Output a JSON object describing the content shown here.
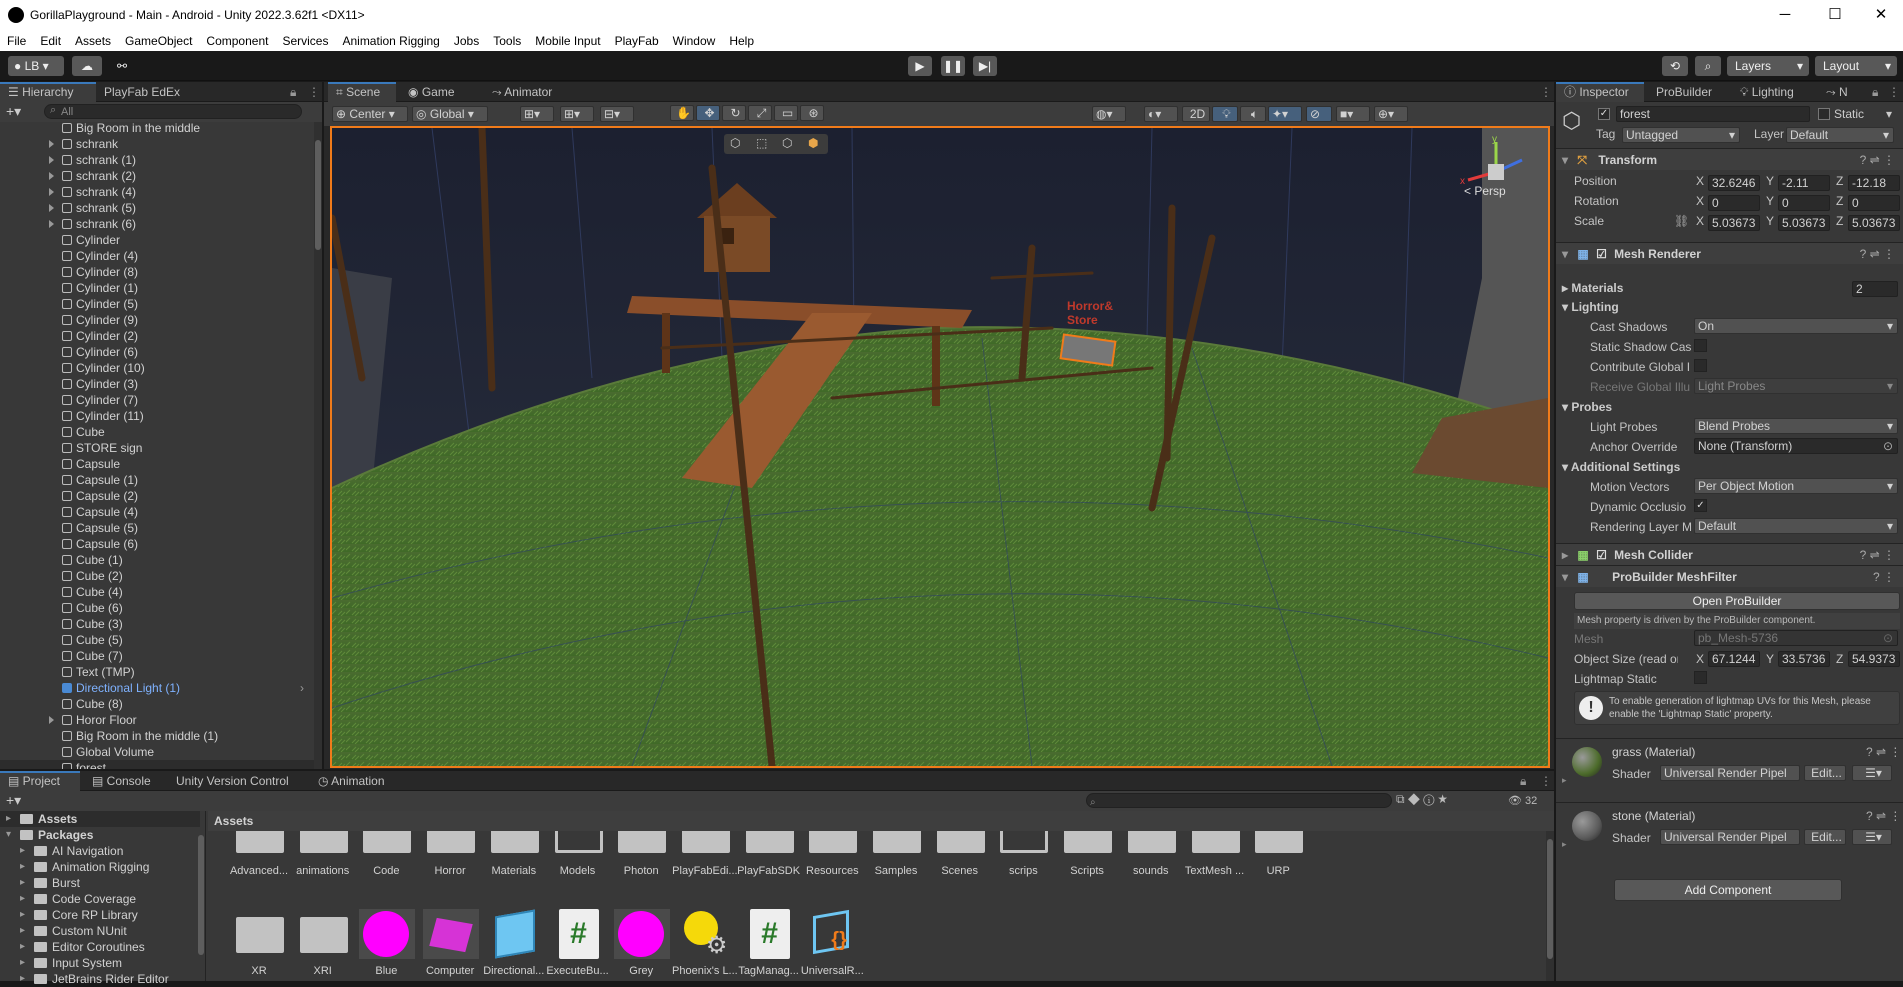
{
  "window": {
    "title": "GorillaPlayground - Main - Android - Unity 2022.3.62f1 <DX11>",
    "minimize": "─",
    "maximize": "☐",
    "close": "✕"
  },
  "menu": [
    "File",
    "Edit",
    "Assets",
    "GameObject",
    "Component",
    "Services",
    "Animation Rigging",
    "Jobs",
    "Tools",
    "Mobile Input",
    "PlayFab",
    "Window",
    "Help"
  ],
  "toolbar": {
    "account": "LB",
    "layers": "Layers",
    "layout": "Layout"
  },
  "hierarchy": {
    "tabs": [
      "Hierarchy",
      "PlayFab EdEx"
    ],
    "search_placeholder": "All",
    "items": [
      {
        "label": "Big Room in the middle",
        "expand": false
      },
      {
        "label": "schrank",
        "expand": true
      },
      {
        "label": "schrank (1)",
        "expand": true
      },
      {
        "label": "schrank (2)",
        "expand": true
      },
      {
        "label": "schrank (4)",
        "expand": true
      },
      {
        "label": "schrank (5)",
        "expand": true
      },
      {
        "label": "schrank (6)",
        "expand": true
      },
      {
        "label": "Cylinder",
        "expand": false
      },
      {
        "label": "Cylinder (4)",
        "expand": false
      },
      {
        "label": "Cylinder (8)",
        "expand": false
      },
      {
        "label": "Cylinder (1)",
        "expand": false
      },
      {
        "label": "Cylinder (5)",
        "expand": false
      },
      {
        "label": "Cylinder (9)",
        "expand": false
      },
      {
        "label": "Cylinder (2)",
        "expand": false
      },
      {
        "label": "Cylinder (6)",
        "expand": false
      },
      {
        "label": "Cylinder (10)",
        "expand": false
      },
      {
        "label": "Cylinder (3)",
        "expand": false
      },
      {
        "label": "Cylinder (7)",
        "expand": false
      },
      {
        "label": "Cylinder (11)",
        "expand": false
      },
      {
        "label": "Cube",
        "expand": false
      },
      {
        "label": "STORE sign",
        "expand": false
      },
      {
        "label": "Capsule",
        "expand": false
      },
      {
        "label": "Capsule (1)",
        "expand": false
      },
      {
        "label": "Capsule (2)",
        "expand": false
      },
      {
        "label": "Capsule (4)",
        "expand": false
      },
      {
        "label": "Capsule (5)",
        "expand": false
      },
      {
        "label": "Capsule (6)",
        "expand": false
      },
      {
        "label": "Cube (1)",
        "expand": false
      },
      {
        "label": "Cube (2)",
        "expand": false
      },
      {
        "label": "Cube (4)",
        "expand": false
      },
      {
        "label": "Cube (6)",
        "expand": false
      },
      {
        "label": "Cube (3)",
        "expand": false
      },
      {
        "label": "Cube (5)",
        "expand": false
      },
      {
        "label": "Cube (7)",
        "expand": false
      },
      {
        "label": "Text (TMP)",
        "expand": false
      },
      {
        "label": "Directional Light (1)",
        "expand": false,
        "highlight": true
      },
      {
        "label": "Cube (8)",
        "expand": false
      },
      {
        "label": "Horor Floor",
        "expand": true
      },
      {
        "label": "Big Room in the middle (1)",
        "expand": false
      },
      {
        "label": "Global Volume",
        "expand": false
      },
      {
        "label": "forest",
        "expand": false
      }
    ]
  },
  "scene": {
    "tabs": [
      "Scene",
      "Game",
      "Animator"
    ],
    "pivot": "Center",
    "space": "Global",
    "mode2d": "2D",
    "persp": "< Persp",
    "sign": "Horror&\nStore"
  },
  "inspector": {
    "tabs": [
      "Inspector",
      "ProBuilder",
      "Lighting",
      "N"
    ],
    "object_name": "forest",
    "static_label": "Static",
    "tag_label": "Tag",
    "tag_value": "Untagged",
    "layer_label": "Layer",
    "layer_value": "Default",
    "transform": {
      "title": "Transform",
      "position_label": "Position",
      "rotation_label": "Rotation",
      "scale_label": "Scale",
      "pos": [
        "32.6246",
        "-2.11",
        "-12.18"
      ],
      "rot": [
        "0",
        "0",
        "0"
      ],
      "scale": [
        "5.03673",
        "5.03673",
        "5.03673"
      ]
    },
    "mesh_renderer": {
      "title": "Mesh Renderer",
      "materials_label": "Materials",
      "materials_count": "2",
      "lighting_label": "Lighting",
      "cast_shadows_label": "Cast Shadows",
      "cast_shadows_value": "On",
      "static_shadow_label": "Static Shadow Cas",
      "contribute_gi_label": "Contribute Global I",
      "receive_gi_label": "Receive Global Illu",
      "receive_gi_value": "Light Probes",
      "probes_label": "Probes",
      "light_probes_label": "Light Probes",
      "light_probes_value": "Blend Probes",
      "anchor_label": "Anchor Override",
      "anchor_value": "None (Transform)",
      "additional_label": "Additional Settings",
      "motion_label": "Motion Vectors",
      "motion_value": "Per Object Motion",
      "dynamic_occ_label": "Dynamic Occlusio",
      "rendering_layer_label": "Rendering Layer M",
      "rendering_layer_value": "Default"
    },
    "mesh_collider": {
      "title": "Mesh Collider"
    },
    "probuilder_meshfilter": {
      "title": "ProBuilder MeshFilter",
      "open_button": "Open ProBuilder",
      "note": "Mesh property is driven by the ProBuilder component.",
      "mesh_label": "Mesh",
      "mesh_value": "pb_Mesh-5736",
      "size_label": "Object Size (read only",
      "size": [
        "67.1244",
        "33.5736",
        "54.9373"
      ],
      "lightmap_label": "Lightmap Static",
      "help": "To enable generation of lightmap UVs for this Mesh, please enable the 'Lightmap Static' property."
    },
    "materials": [
      {
        "name": "grass (Material)",
        "shader_label": "Shader",
        "shader": "Universal Render Pipel",
        "edit": "Edit...",
        "color": "#4c6b2a"
      },
      {
        "name": "stone (Material)",
        "shader_label": "Shader",
        "shader": "Universal Render Pipel",
        "edit": "Edit...",
        "color": "#5b5b5b"
      }
    ],
    "add_component": "Add Component"
  },
  "project": {
    "tabs": [
      "Project",
      "Console",
      "Unity Version Control",
      "Animation"
    ],
    "count": "32",
    "breadcrumb": "Assets",
    "tree": [
      {
        "label": "Assets",
        "bold": true,
        "level": 0
      },
      {
        "label": "Packages",
        "bold": true,
        "level": 0
      },
      {
        "label": "AI Navigation",
        "level": 1
      },
      {
        "label": "Animation Rigging",
        "level": 1
      },
      {
        "label": "Burst",
        "level": 1
      },
      {
        "label": "Code Coverage",
        "level": 1
      },
      {
        "label": "Core RP Library",
        "level": 1
      },
      {
        "label": "Custom NUnit",
        "level": 1
      },
      {
        "label": "Editor Coroutines",
        "level": 1
      },
      {
        "label": "Input System",
        "level": 1
      },
      {
        "label": "JetBrains Rider Editor",
        "level": 1
      }
    ],
    "row1": [
      "Advanced...",
      "animations",
      "Code",
      "Horror",
      "Materials",
      "Models",
      "Photon",
      "PlayFabEdi...",
      "PlayFabSDK",
      "Resources",
      "Samples",
      "Scenes",
      "scrips",
      "Scripts",
      "sounds",
      "TextMesh ...",
      "URP"
    ],
    "row2": [
      "XR",
      "XRI",
      "Blue",
      "Computer",
      "Directional...",
      "ExecuteBu...",
      "Grey",
      "Phoenix's L...",
      "TagManag...",
      "UniversalR..."
    ]
  }
}
